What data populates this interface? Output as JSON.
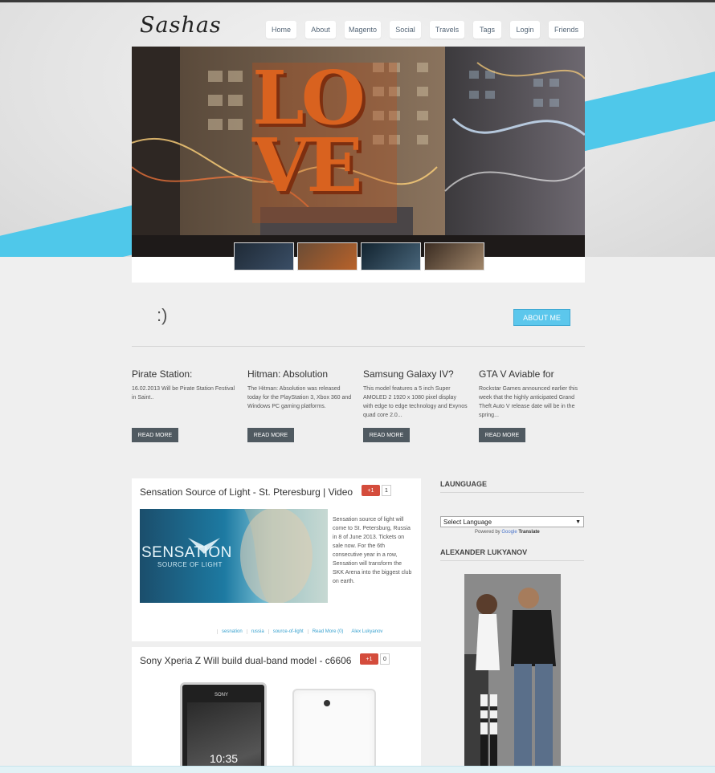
{
  "site": {
    "logo": "Sashas"
  },
  "nav": [
    "Home",
    "About",
    "Magento",
    "Social",
    "Travels",
    "Tags",
    "Login",
    "Friends"
  ],
  "hero": {
    "big_text": "LOVE"
  },
  "intro": {
    "smile": ":)",
    "about_button": "ABOUT ME"
  },
  "teasers": [
    {
      "title": "Pirate Station:",
      "text": "16.02.2013 Will be Pirate Station Festival in Saint..",
      "button": "READ MORE"
    },
    {
      "title": "Hitman: Absolution",
      "text": "The Hitman: Absolution was released today for the PlayStation 3, Xbox 360 and Windows PC gaming platforms.",
      "button": "READ MORE"
    },
    {
      "title": "Samsung Galaxy IV?",
      "text": "This model features a 5 inch Super AMOLED 2 1920 x 1080 pixel display with edge to edge technology and Exynos quad core 2.0...",
      "button": "READ MORE"
    },
    {
      "title": "GTA V Aviable for",
      "text": "Rockstar Games announced earlier this week that the highly anticipated Grand Theft Auto V release date will be in the spring...",
      "button": "READ MORE"
    }
  ],
  "posts": [
    {
      "title": "Sensation Source of Light - St. Pteresburg | Video",
      "gplus": "+1",
      "count": "1",
      "image_title": "SENSATION",
      "image_sub": "SOURCE OF LIGHT",
      "excerpt": "Sensation source of light will come to St. Petersburg, Russia in 8 of June 2013. Tickets on sale now. For the 6th consecutive year in a row, Sensation will transform the SKK Arena into the biggest club on earth.",
      "tags": [
        "sesnation",
        "russia",
        "source-of-light",
        "Read More (0)",
        "Alex Lukyanov"
      ]
    },
    {
      "title": "Sony Xperia Z Will build dual-band model - c6606",
      "gplus": "+1",
      "count": "0",
      "phone_brand": "SONY",
      "phone_time": "10:35"
    }
  ],
  "sidebar": {
    "language_heading": "LAUNGUAGE",
    "select_label": "Select Language",
    "powered_by": "Powered by",
    "google": "Google",
    "translate": "Translate",
    "author_heading": "ALEXANDER LUKYANOV"
  },
  "colors": {
    "accent": "#4fc8ea",
    "button_dark": "#505a61",
    "gplus": "#d44c3c"
  }
}
